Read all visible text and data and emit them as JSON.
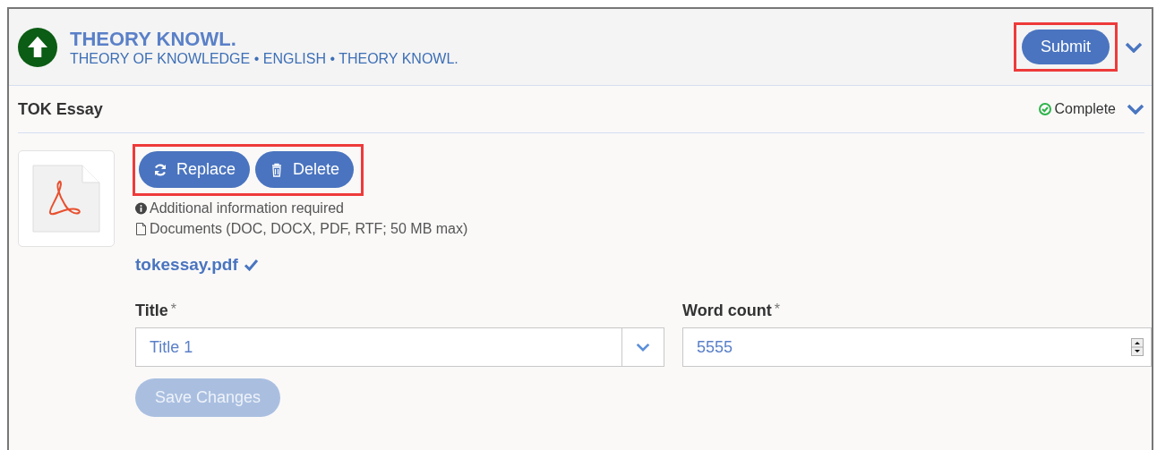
{
  "header": {
    "title": "THEORY KNOWL.",
    "subtitle": "THEORY OF KNOWLEDGE • ENGLISH • THEORY KNOWL.",
    "submit": {
      "label": "Submit",
      "highlighted": true
    },
    "expanded": false
  },
  "section": {
    "title": "TOK Essay",
    "status": {
      "label": "Complete",
      "complete": true
    },
    "expanded": false
  },
  "file_actions": {
    "highlighted": true,
    "buttons": [
      {
        "kind": "replace",
        "label": "Replace"
      },
      {
        "kind": "delete",
        "label": "Delete"
      }
    ]
  },
  "notes": [
    {
      "kind": "info",
      "text": "Additional information required"
    },
    {
      "kind": "document",
      "text": "Documents (DOC, DOCX, PDF, RTF; 50 MB max)"
    }
  ],
  "uploaded_file": {
    "name": "tokessay.pdf",
    "verified": true
  },
  "fields": [
    {
      "kind": "select",
      "label": "Title",
      "required_mark": "*",
      "value": "Title 1"
    },
    {
      "kind": "number",
      "label": "Word count",
      "required_mark": "*",
      "value": "5555"
    }
  ],
  "save_button": {
    "label": "Save Changes",
    "disabled": true
  }
}
